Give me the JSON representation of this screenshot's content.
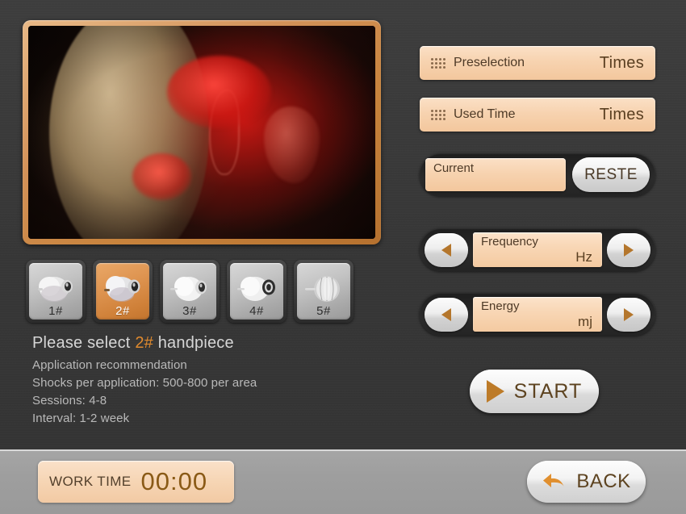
{
  "image_panel": {
    "name": "anatomical-illustration",
    "description": "Anatomical illustration of pelvic region with red highlighted treatment area"
  },
  "handpieces": {
    "selected_index": 1,
    "items": [
      {
        "label": "1#",
        "icon": "handpiece-rounded-icon"
      },
      {
        "label": "2#",
        "icon": "handpiece-rounded-icon"
      },
      {
        "label": "3#",
        "icon": "handpiece-rounded-icon"
      },
      {
        "label": "4#",
        "icon": "handpiece-ring-icon"
      },
      {
        "label": "5#",
        "icon": "handpiece-fan-icon"
      }
    ]
  },
  "info": {
    "headline_prefix": "Please select ",
    "headline_highlight": "2#",
    "headline_suffix": " handpiece",
    "lines": [
      "Application recommendation",
      "Shocks per application:   500-800 per area",
      "Sessions:   4-8",
      "Interval:  1-2 week"
    ]
  },
  "panel": {
    "preselection": {
      "label": "Preselection",
      "unit": "Times",
      "value": ""
    },
    "used_time": {
      "label": "Used Time",
      "unit": "Times",
      "value": ""
    },
    "current": {
      "label": "Current",
      "value": "",
      "reset_label": "RESTE"
    },
    "frequency": {
      "label": "Frequency",
      "unit": "Hz",
      "value": "",
      "dec": "◀",
      "inc": "▶"
    },
    "energy": {
      "label": "Energy",
      "unit": "mj",
      "value": "",
      "dec": "◀",
      "inc": "▶"
    },
    "start": {
      "label": "START",
      "icon": "play-triangle-icon"
    }
  },
  "bottom": {
    "work_time_label": "WORK TIME",
    "work_time_value": "00:00",
    "back_label": "BACK",
    "back_icon": "arrow-left-curved-icon"
  },
  "colors": {
    "background": "#3b3b3b",
    "accent_orange": "#d98b4a",
    "peach_field": "#f7d3b0",
    "frame_border": "#c8833c",
    "text_brown": "#5a3f21",
    "bottom_bar": "#9e9e9e"
  }
}
